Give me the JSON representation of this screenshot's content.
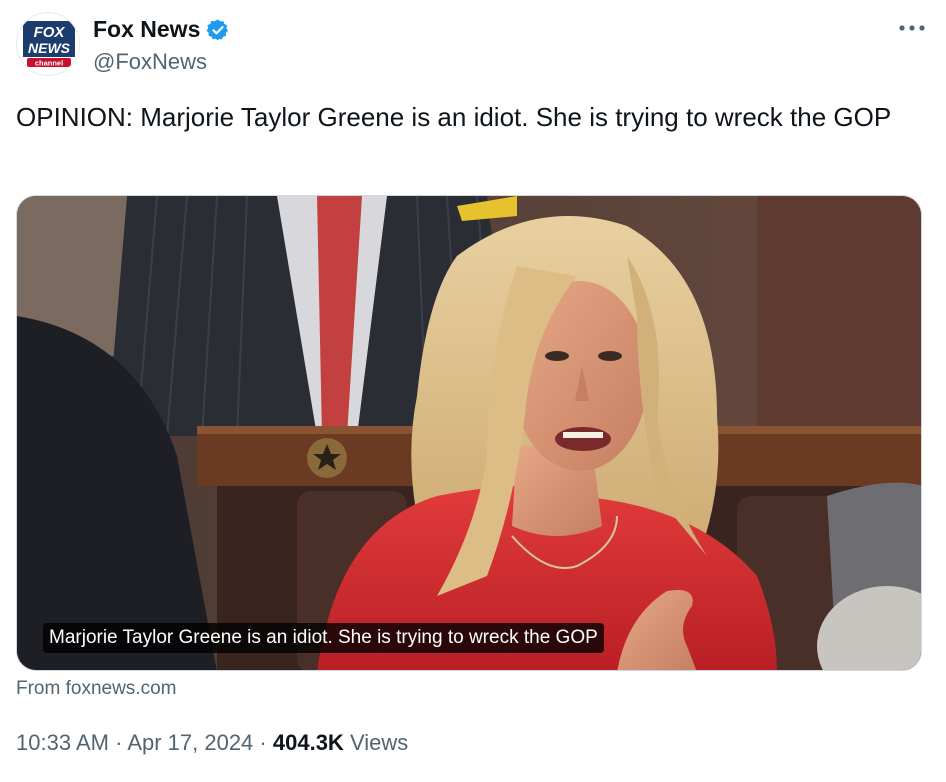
{
  "author": {
    "display_name": "Fox News",
    "handle": "@FoxNews",
    "verified": true,
    "logo_text_top": "FOX",
    "logo_text_middle": "NEWS",
    "logo_text_bottom": "channel",
    "icon": "verified-badge-icon",
    "verified_color": "#1d9bf0"
  },
  "more_menu": {
    "icon": "more-horizontal-icon"
  },
  "tweet": {
    "text": "OPINION: Marjorie Taylor Greene is an idiot. She is trying to wreck the GOP"
  },
  "media": {
    "caption": "Marjorie Taylor Greene is an idiot. She is trying to wreck the GOP",
    "source": "From foxnews.com"
  },
  "meta": {
    "time": "10:33 AM",
    "separator": "·",
    "date": "Apr 17, 2024",
    "views_count": "404.3K",
    "views_label": "Views"
  },
  "colors": {
    "primary_text": "#0f1419",
    "secondary_text": "#536471",
    "accent": "#1d9bf0"
  }
}
